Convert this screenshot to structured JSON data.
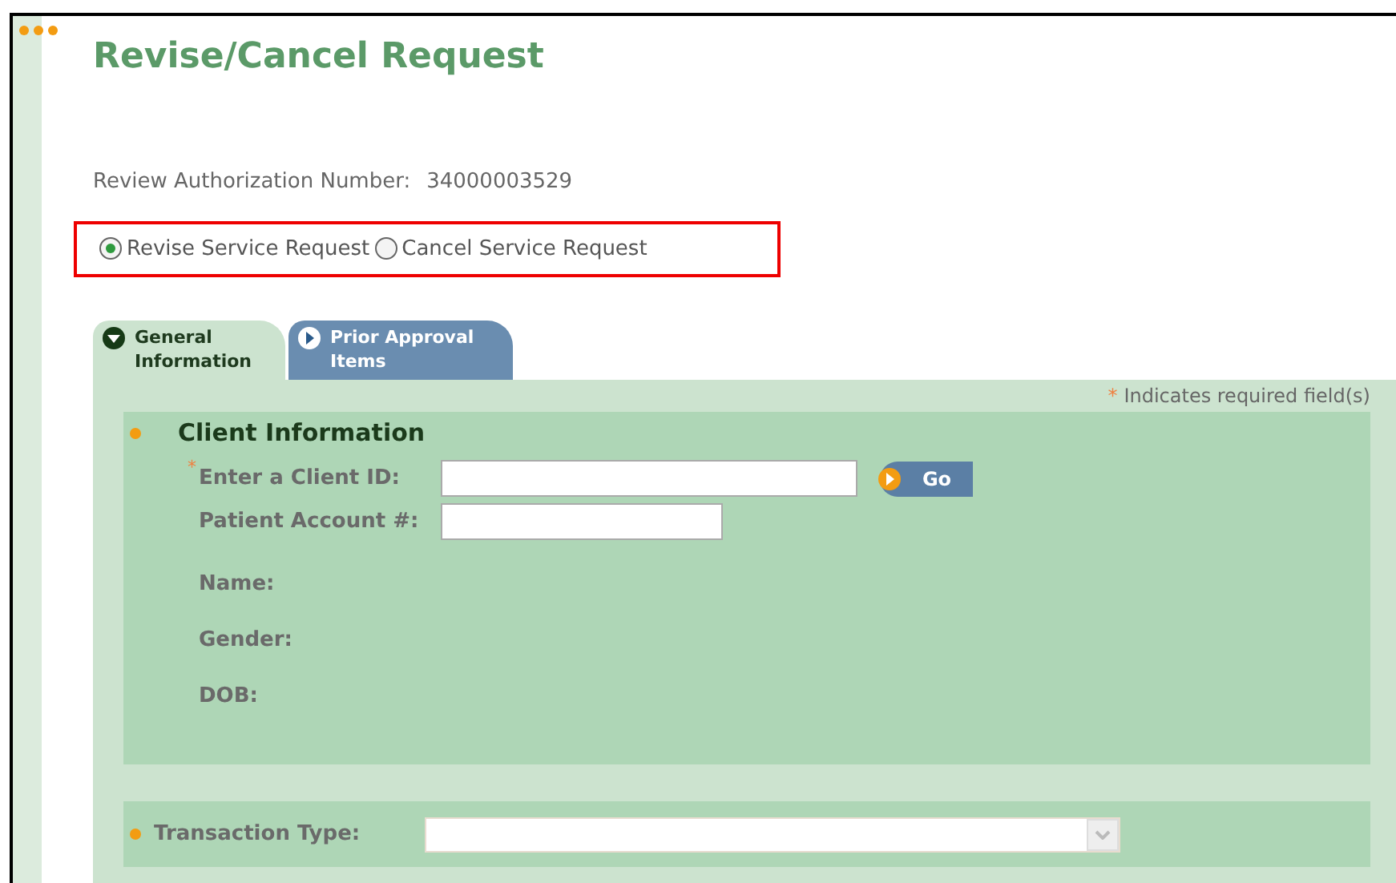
{
  "title": "Revise/Cancel Request",
  "authorization": {
    "label": "Review Authorization Number:",
    "value": "34000003529"
  },
  "request_options": [
    {
      "label": "Revise Service Request",
      "selected": true
    },
    {
      "label": "Cancel Service Request",
      "selected": false
    }
  ],
  "tabs": [
    {
      "label": "General Information",
      "selected": true
    },
    {
      "label": "Prior Approval Items",
      "selected": false
    }
  ],
  "required_note": {
    "mark": "*",
    "text": "Indicates required field(s)"
  },
  "client_section": {
    "title": "Client Information",
    "fields": [
      {
        "kind": "input",
        "label": "Enter a Client ID:",
        "required": true,
        "button": "Go"
      },
      {
        "kind": "input",
        "label": "Patient Account #:",
        "required": false
      },
      {
        "kind": "text",
        "label": "Name:"
      },
      {
        "kind": "text",
        "label": "Gender:"
      },
      {
        "kind": "text",
        "label": "DOB:"
      }
    ]
  },
  "transaction": {
    "label": "Transaction Type:"
  }
}
